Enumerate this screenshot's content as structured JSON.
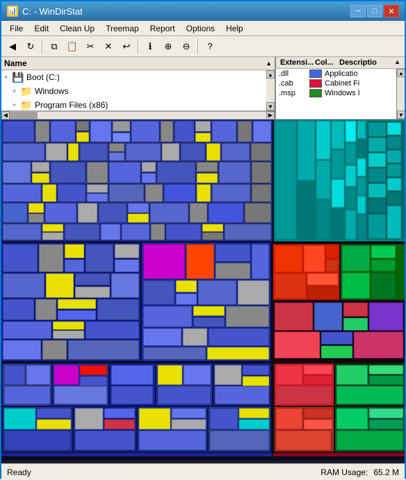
{
  "window": {
    "title": "C: - WinDirStat",
    "icon": "📊"
  },
  "titleButtons": {
    "minimize": "─",
    "restore": "□",
    "close": "✕"
  },
  "menuBar": {
    "items": [
      "File",
      "Edit",
      "Clean Up",
      "Treemap",
      "Report",
      "Options",
      "Help"
    ]
  },
  "toolbar": {
    "buttons": [
      {
        "name": "back-button",
        "icon": "◀"
      },
      {
        "name": "refresh-button",
        "icon": "↻"
      },
      {
        "name": "separator1",
        "icon": "|"
      },
      {
        "name": "copy-button",
        "icon": "📋"
      },
      {
        "name": "paste-button",
        "icon": "📄"
      },
      {
        "name": "cut-button",
        "icon": "✂"
      },
      {
        "name": "delete-button",
        "icon": "🗑"
      },
      {
        "name": "separator2",
        "icon": "|"
      },
      {
        "name": "undo-button",
        "icon": "↩"
      },
      {
        "name": "separator3",
        "icon": "|"
      },
      {
        "name": "properties-button",
        "icon": "ℹ"
      },
      {
        "name": "zoom-in-button",
        "icon": "🔍"
      },
      {
        "name": "zoom-out-button",
        "icon": "🔎"
      },
      {
        "name": "separator4",
        "icon": "|"
      },
      {
        "name": "help-button",
        "icon": "?"
      }
    ]
  },
  "fileTree": {
    "header": "Name",
    "items": [
      {
        "label": "Boot (C:)",
        "type": "disk",
        "expanded": false,
        "indent": 0
      },
      {
        "label": "Windows",
        "type": "folder",
        "expanded": true,
        "indent": 1
      },
      {
        "label": "Program Files (x86)",
        "type": "folder",
        "expanded": false,
        "indent": 1
      }
    ]
  },
  "extensions": {
    "headers": [
      "Extensi...",
      "Col...",
      "Descriptio"
    ],
    "items": [
      {
        "ext": ".dll",
        "color": "#4169E1",
        "desc": "Applicatio"
      },
      {
        "ext": ".cab",
        "color": "#DC143C",
        "desc": "Cabinet Fi"
      },
      {
        "ext": ".msp",
        "color": "#228B22",
        "desc": "Windows I"
      }
    ]
  },
  "statusBar": {
    "status": "Ready",
    "ramLabel": "RAM Usage:",
    "ramValue": "65.2 M"
  }
}
